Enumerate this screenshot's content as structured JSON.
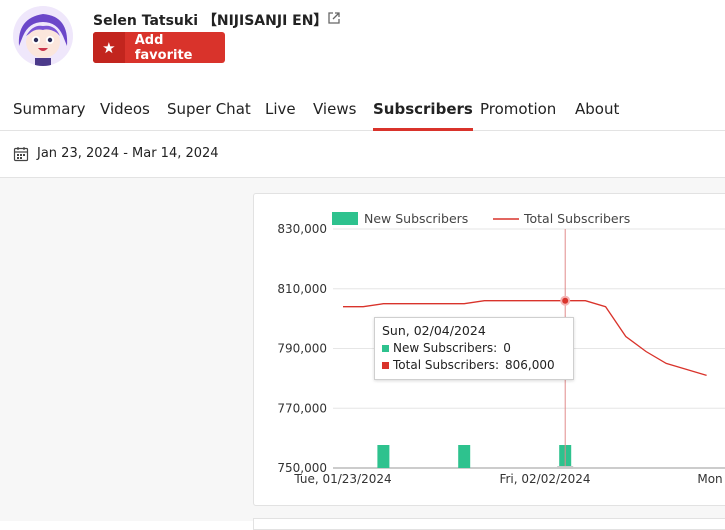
{
  "channel": {
    "name": "Selen Tatsuki 【NIJISANJI EN】",
    "favorite_label": "Add favorite"
  },
  "tabs": [
    {
      "label": "Summary",
      "active": false
    },
    {
      "label": "Videos",
      "active": false
    },
    {
      "label": "Super Chat",
      "active": false
    },
    {
      "label": "Live",
      "active": false
    },
    {
      "label": "Views",
      "active": false
    },
    {
      "label": "Subscribers",
      "active": true
    },
    {
      "label": "Promotion",
      "active": false
    },
    {
      "label": "About",
      "active": false
    }
  ],
  "date_range": "Jan 23, 2024 - Mar 14, 2024",
  "colors": {
    "accent": "#d9332b",
    "new_subs": "#2ec28e",
    "total_subs": "#d9332b"
  },
  "chart_data": {
    "type": "bar+line",
    "legend": [
      "New Subscribers",
      "Total Subscribers"
    ],
    "legend_position": "top-left",
    "y_ticks": [
      "830,000",
      "810,000",
      "790,000",
      "770,000",
      "750,000"
    ],
    "ylim": [
      750000,
      830000
    ],
    "x_ticks": [
      "Tue, 01/23/2024",
      "Fri, 02/02/2024",
      "Mon"
    ],
    "grid": true,
    "series": [
      {
        "name": "Total Subscribers",
        "type": "line",
        "x": [
          "2024-01-23",
          "2024-01-24",
          "2024-01-25",
          "2024-01-26",
          "2024-01-27",
          "2024-01-28",
          "2024-01-29",
          "2024-01-30",
          "2024-01-31",
          "2024-02-01",
          "2024-02-02",
          "2024-02-03",
          "2024-02-04",
          "2024-02-05",
          "2024-02-06",
          "2024-02-07",
          "2024-02-08",
          "2024-02-09",
          "2024-02-10"
        ],
        "values": [
          804000,
          804000,
          805000,
          805000,
          805000,
          805000,
          805000,
          806000,
          806000,
          806000,
          806000,
          806000,
          806000,
          804000,
          794000,
          789000,
          785000,
          783000,
          781000
        ]
      },
      {
        "name": "New Subscribers",
        "type": "bar",
        "x": [
          "2024-01-25",
          "2024-01-29",
          "2024-02-03"
        ],
        "values": [
          1000,
          1000,
          1000
        ]
      }
    ],
    "tooltip": {
      "date": "Sun, 02/04/2024",
      "new_label": "New Subscribers:",
      "new_value": "0",
      "total_label": "Total Subscribers:",
      "total_value": "806,000"
    }
  }
}
